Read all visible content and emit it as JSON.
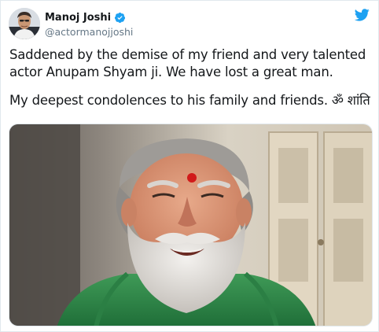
{
  "tweet": {
    "author": {
      "display_name": "Manoj Joshi",
      "handle": "@actormanojjoshi",
      "verified": true,
      "avatar_icon": "user-avatar-photo"
    },
    "platform_icon": "twitter-bird-icon",
    "body": {
      "line1": "Saddened by the demise of my friend and very talented",
      "line2": "actor Anupam Shyam ji. We have lost a great man.",
      "line3": "My deepest condolences to his family and friends. ॐ शांति"
    },
    "media": {
      "kind": "photo"
    },
    "colors": {
      "verified_blue": "#1da1f2",
      "twitter_blue": "#1da1f2",
      "handle_gray": "#657786",
      "text": "#14171a",
      "border": "#e1e8ed"
    }
  }
}
